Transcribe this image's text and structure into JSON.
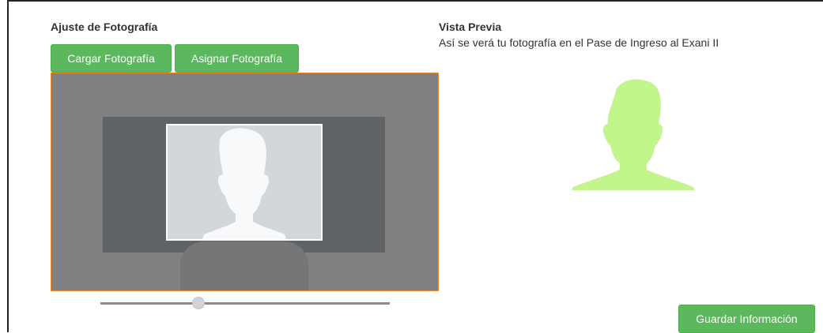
{
  "photo_adjust": {
    "title": "Ajuste de Fotografía",
    "load_button": "Cargar Fotografía",
    "assign_button": "Asignar Fotografía",
    "zoom_level": 0.33
  },
  "preview": {
    "title": "Vista Previa",
    "description": "Así se verá tu fotografía en el Pase de Ingreso al Exani II"
  },
  "save_button": "Guardar Información",
  "colors": {
    "button_green": "#5cb85c",
    "preview_silhouette": "#c2f58c",
    "crop_border": "#e8892e"
  }
}
